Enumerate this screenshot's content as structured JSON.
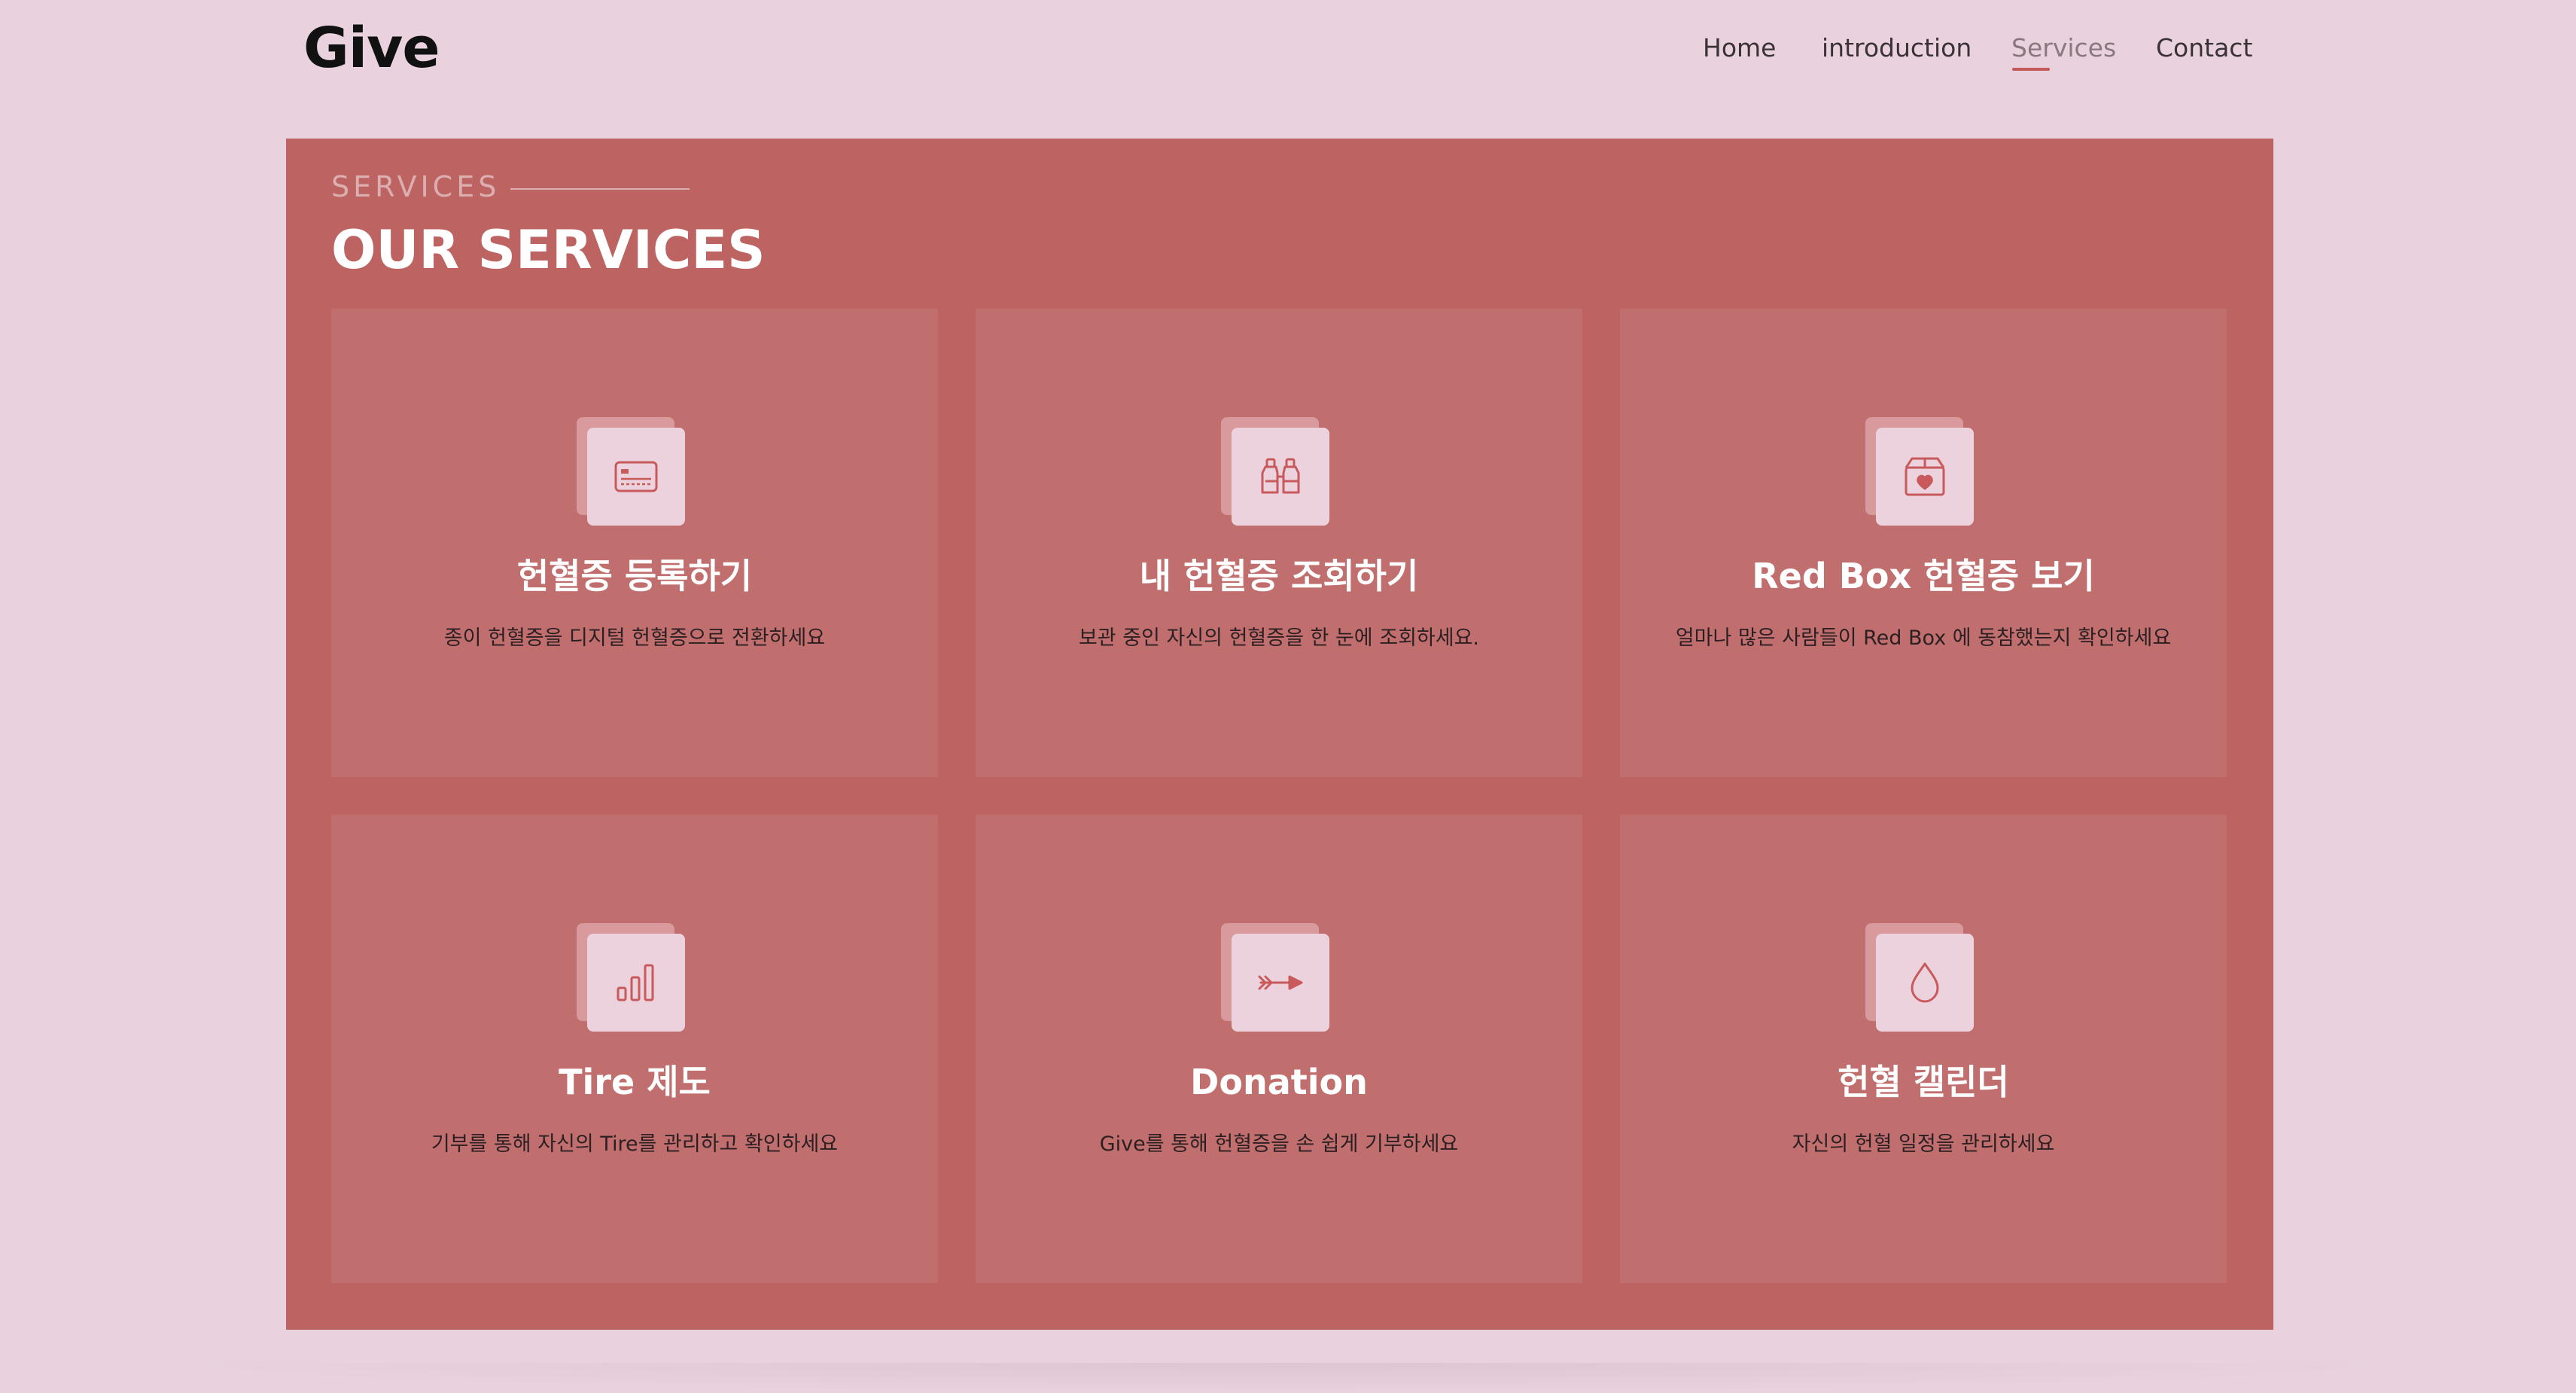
{
  "brand": {
    "logo": "Give"
  },
  "nav": {
    "items": [
      {
        "label": "Home"
      },
      {
        "label": "introduction"
      },
      {
        "label": "Services",
        "active": true
      },
      {
        "label": "Contact"
      }
    ]
  },
  "services": {
    "kicker": "SERVICES",
    "title": "OUR SERVICES",
    "cards": [
      {
        "icon": "id-card-icon",
        "title": "헌혈증 등록하기",
        "desc": "종이 헌혈증을 디지털 헌혈증으로 전환하세요"
      },
      {
        "icon": "binoculars-icon",
        "title": "내 헌혈증 조회하기",
        "desc": "보관 중인 자신의 헌혈증을 한 눈에 조회하세요."
      },
      {
        "icon": "heart-box-icon",
        "title": "Red Box 헌혈증 보기",
        "desc": "얼마나 많은 사람들이 Red Box 에 동참했는지 확인하세요"
      },
      {
        "icon": "bar-chart-icon",
        "title": "Tire 제도",
        "desc": "기부를 통해 자신의 Tire를 관리하고 확인하세요"
      },
      {
        "icon": "arrow-icon",
        "title": "Donation",
        "desc": "Give를 통해 헌혈증을 손 쉽게 기부하세요"
      },
      {
        "icon": "drop-icon",
        "title": "헌혈 캘린더",
        "desc": "자신의 헌혈 일정을 관리하세요"
      }
    ]
  },
  "colors": {
    "background": "#e9d2de",
    "panel": "#bd6462",
    "card": "#c06f6e",
    "icon_tile": "#ecd2dd",
    "accent": "#c45a5a"
  }
}
